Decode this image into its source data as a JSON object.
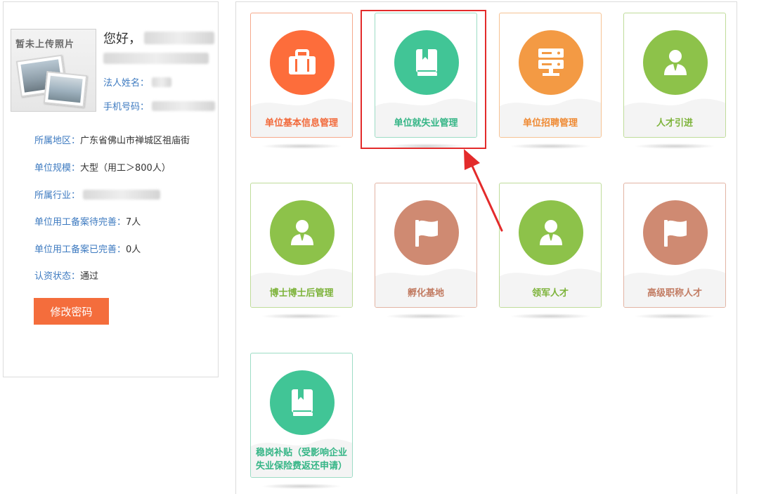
{
  "profile": {
    "photo_placeholder": "暂未上传照片",
    "greeting": "您好，",
    "legal_name_label": "法人姓名：",
    "phone_label": "手机号码：",
    "region_label": "所属地区：",
    "region_value": "广东省佛山市禅城区祖庙街",
    "scale_label": "单位规模：",
    "scale_value": "大型（用工＞800人）",
    "industry_label": "所属行业：",
    "pending_label": "单位用工备案待完善：",
    "pending_value": "7人",
    "done_label": "单位用工备案已完善：",
    "done_value": "0人",
    "cert_label": "认资状态：",
    "cert_value": "通过",
    "change_password": "修改密码"
  },
  "tiles": [
    {
      "label": "单位基本信息管理",
      "icon": "briefcase-icon",
      "color": "#fd6d3b",
      "text_color": "#f2693a",
      "border": "#f5a98c"
    },
    {
      "label": "单位就失业管理",
      "icon": "book-icon",
      "color": "#41c596",
      "text_color": "#35b586",
      "border": "#9ddcc5"
    },
    {
      "label": "单位招聘管理",
      "icon": "server-icon",
      "color": "#f39a44",
      "text_color": "#ef8a33",
      "border": "#f6c293"
    },
    {
      "label": "人才引进",
      "icon": "person-icon",
      "color": "#8dc24a",
      "text_color": "#7db33a",
      "border": "#bfdc9a"
    },
    {
      "label": "博士博士后管理",
      "icon": "person-icon",
      "color": "#8dc24a",
      "text_color": "#7db33a",
      "border": "#bfdc9a"
    },
    {
      "label": "孵化基地",
      "icon": "flag-icon",
      "color": "#cf8a72",
      "text_color": "#c27c63",
      "border": "#e2b4a4"
    },
    {
      "label": "领军人才",
      "icon": "person-icon",
      "color": "#8dc24a",
      "text_color": "#7db33a",
      "border": "#bfdc9a"
    },
    {
      "label": "高级职称人才",
      "icon": "flag-icon",
      "color": "#cf8a72",
      "text_color": "#c27c63",
      "border": "#e2b4a4"
    },
    {
      "label": "稳岗补贴（受影响企业失业保险费返还申请）",
      "icon": "book-icon",
      "color": "#41c596",
      "text_color": "#35b586",
      "border": "#9ddcc5"
    }
  ]
}
